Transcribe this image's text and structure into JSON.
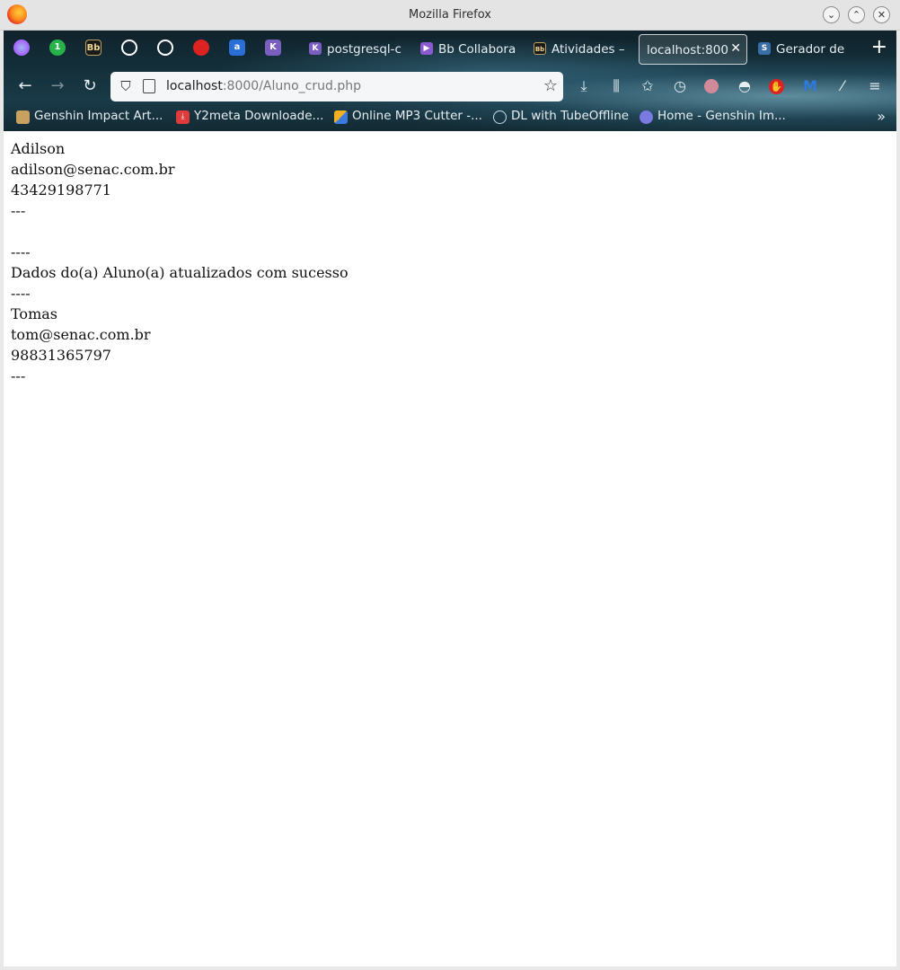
{
  "window": {
    "title": "Mozilla Firefox",
    "buttons": [
      "⌄",
      "⌃",
      "✕"
    ]
  },
  "tabs": {
    "pinned": [
      {
        "icon": "firefox-view-icon",
        "label": ""
      },
      {
        "icon": "whatsapp-icon",
        "label": "1"
      },
      {
        "icon": "blackboard-icon",
        "label": "Bb"
      },
      {
        "icon": "github-icon",
        "label": ""
      },
      {
        "icon": "github-icon",
        "label": ""
      },
      {
        "icon": "extension-icon",
        "label": ""
      },
      {
        "icon": "amazon-icon",
        "label": "a"
      },
      {
        "icon": "heroku-icon",
        "label": "K"
      }
    ],
    "items": [
      {
        "label": "postgresql-c",
        "icon": "heroku-icon"
      },
      {
        "label": "Bb Collabora",
        "icon": "collaborate-icon"
      },
      {
        "label": "Atividades –",
        "icon": "blackboard-icon"
      },
      {
        "label": "localhost:800",
        "active": true
      },
      {
        "label": "Gerador de",
        "icon": "python-icon"
      }
    ],
    "new_tab": "+",
    "close": "✕"
  },
  "navbar": {
    "url_host": "localhost",
    "url_path": ":8000/Aluno_crud.php"
  },
  "bookmarks": [
    {
      "label": "Genshin Impact Art...",
      "icon": "bookmark-icon",
      "color": "#c8a060"
    },
    {
      "label": "Y2meta Downloade...",
      "icon": "download-icon",
      "color": "#e03a3a"
    },
    {
      "label": "Online MP3 Cutter -...",
      "icon": "cutter-icon",
      "color": "#3a7ae0"
    },
    {
      "label": "DL with TubeOffline",
      "icon": "globe-icon",
      "color": "#9ab"
    },
    {
      "label": "Home - Genshin Im...",
      "icon": "discord-icon",
      "color": "#7a7ae0"
    }
  ],
  "page": {
    "lines": [
      "Adilson",
      "adilson@senac.com.br",
      "43429198771",
      "---",
      "",
      "----",
      "Dados do(a) Aluno(a) atualizados com sucesso",
      "----",
      "Tomas",
      "tom@senac.com.br",
      "98831365797",
      "---"
    ]
  }
}
